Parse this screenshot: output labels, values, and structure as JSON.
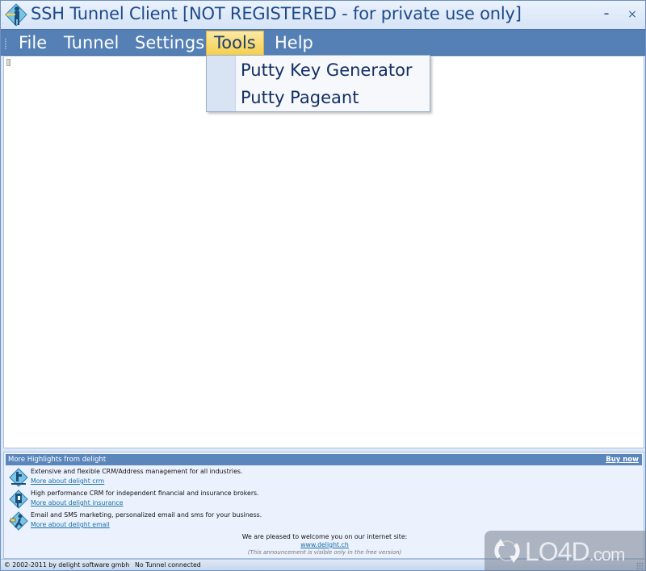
{
  "window": {
    "title": "SSH Tunnel Client [NOT REGISTERED - for private use only]",
    "minimize_label": "–",
    "close_label": "×"
  },
  "menu": {
    "items": [
      {
        "label": "File"
      },
      {
        "label": "Tunnel"
      },
      {
        "label": "Settings"
      },
      {
        "label": "Tools",
        "active": true
      },
      {
        "label": "Help"
      }
    ]
  },
  "tools_menu": {
    "items": [
      {
        "label": "Putty Key Generator"
      },
      {
        "label": "Putty Pageant"
      }
    ]
  },
  "highlights": {
    "header": "More Highlights from delight",
    "buy_now": "Buy now",
    "items": [
      {
        "icon": "crm-icon",
        "description": "Extensive and flexible CRM/Address management for all industries.",
        "link": "More about delight crm"
      },
      {
        "icon": "insurance-icon",
        "description": "High performance CRM for independent financial and insurance brokers.",
        "link": "More about delight insurance"
      },
      {
        "icon": "email-icon",
        "description": "Email and SMS marketing, personalized email and sms for your business.",
        "link": "More about delight email"
      }
    ],
    "welcome_text": "We are pleased to welcome you on our internet site:",
    "welcome_link": "www.delight.ch",
    "welcome_note": "(This announcement is visible only in the free version)"
  },
  "status": {
    "copyright": "© 2002-2011 by delight software gmbh",
    "connection": "No Tunnel connected"
  },
  "watermark": {
    "brand": "LO4D",
    "suffix": ".com"
  },
  "colors": {
    "menubar": "#5580b5",
    "menu_active": "#f5cf4e",
    "link": "#1a6fa6",
    "title_text": "#1f4a8a"
  }
}
